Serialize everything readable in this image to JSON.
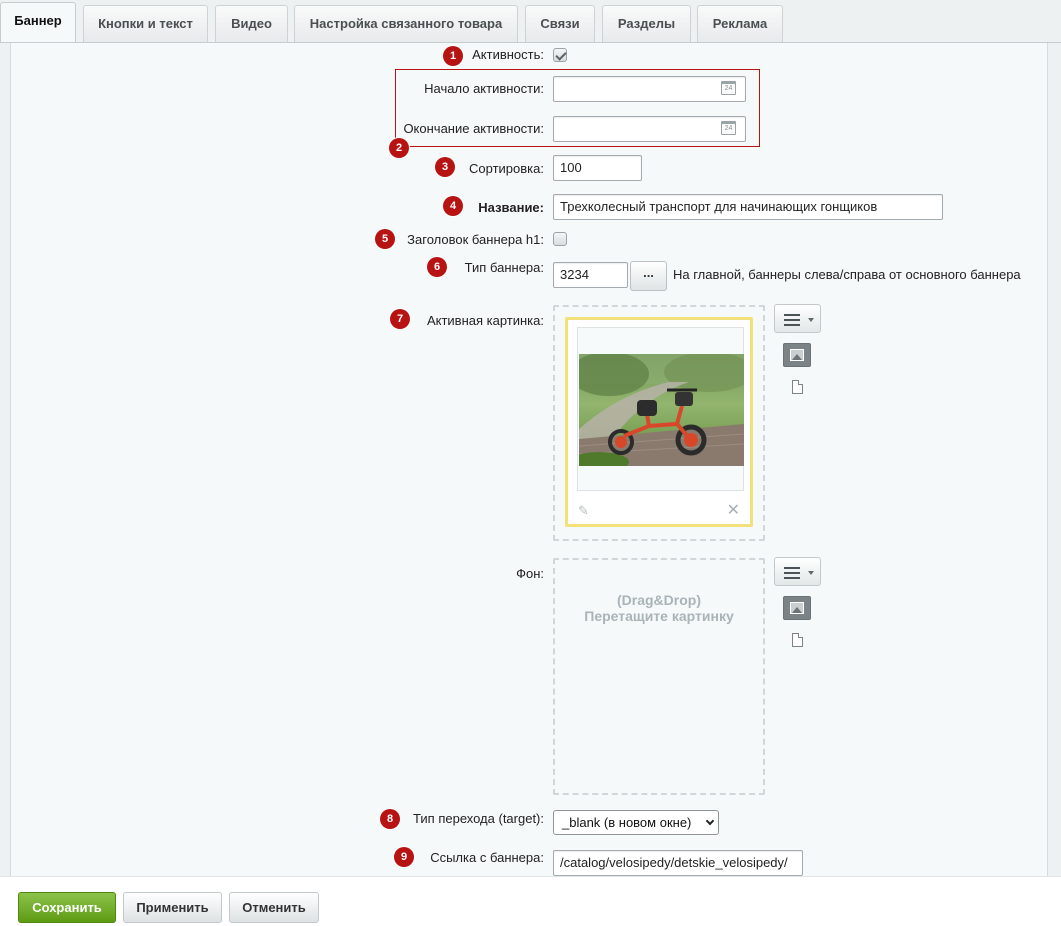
{
  "tabs": [
    "Баннер",
    "Кнопки и текст",
    "Видео",
    "Настройка связанного товара",
    "Связи",
    "Разделы",
    "Реклама"
  ],
  "badges": [
    "1",
    "2",
    "3",
    "4",
    "5",
    "6",
    "7",
    "8",
    "9"
  ],
  "form": {
    "activity_label": "Активность:",
    "activity_checked": true,
    "start_label": "Начало активности:",
    "start_value": "",
    "end_label": "Окончание активности:",
    "end_value": "",
    "calendar_icon_text": "24",
    "sort_label": "Сортировка:",
    "sort_value": "100",
    "name_label": "Название:",
    "name_value": "Трехколесный транспорт для начинающих гонщиков",
    "h1_label": "Заголовок баннера h1:",
    "h1_checked": false,
    "banner_type_label": "Тип баннера:",
    "banner_type_value": "3234",
    "banner_type_button": "...",
    "banner_type_desc": "На главной, баннеры слева/справа от основного баннера",
    "active_image_label": "Активная картинка:",
    "background_label": "Фон:",
    "dropzone_line1": "(Drag&Drop)",
    "dropzone_line2": "Перетащите картинку",
    "target_label": "Тип перехода (target):",
    "target_value": "_blank (в новом окне)",
    "link_label": "Ссылка с баннера:",
    "link_value": "/catalog/velosipedy/detskie_velosipedy/"
  },
  "footer": {
    "save": "Сохранить",
    "apply": "Применить",
    "cancel": "Отменить"
  },
  "icons": {
    "calendar": "calendar-icon",
    "menu": "menu-icon",
    "image": "image-icon",
    "file": "file-icon",
    "edit": "pencil-icon",
    "delete": "close-icon"
  },
  "colors": {
    "badge": "#b81313",
    "save_button": "#6ea820",
    "highlight_border": "#b81313",
    "image_card_border": "#f2e07a"
  }
}
